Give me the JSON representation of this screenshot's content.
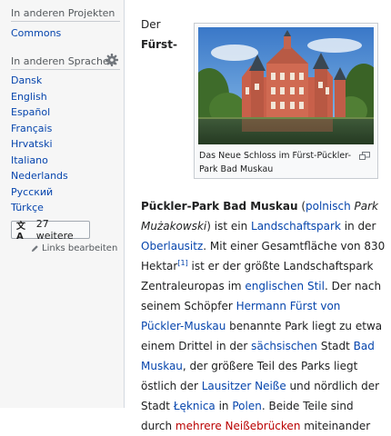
{
  "sidebar": {
    "projects_heading": "In anderen Projekten",
    "projects": [
      "Commons"
    ],
    "languages_heading": "In anderen Sprachen",
    "languages": [
      "Dansk",
      "English",
      "Español",
      "Français",
      "Hrvatski",
      "Italiano",
      "Nederlands",
      "Русский",
      "Türkçe"
    ],
    "more_button": "27 weitere",
    "edit_links": "Links bearbeiten"
  },
  "article": {
    "intro_der": "Der",
    "intro_title": "Fürst-",
    "thumb_caption": "Das Neue Schloss im Fürst-Pückler-Park Bad Muskau",
    "paragraph": [
      {
        "t": "b",
        "text": "Pückler-Park Bad Muskau"
      },
      {
        "t": "s",
        "text": " ("
      },
      {
        "t": "a",
        "text": "polnisch"
      },
      {
        "t": "s",
        "text": " "
      },
      {
        "t": "i",
        "text": "Park Mużakowski"
      },
      {
        "t": "s",
        "text": ") ist ein "
      },
      {
        "t": "a",
        "text": "Landschaftspark"
      },
      {
        "t": "s",
        "text": " in der "
      },
      {
        "t": "a",
        "text": "Oberlausitz"
      },
      {
        "t": "s",
        "text": ". Mit einer Gesamtfläche von 830 Hektar"
      },
      {
        "t": "sup",
        "text": "[1]"
      },
      {
        "t": "s",
        "text": " ist er der größte Landschaftspark Zentraleuropas im "
      },
      {
        "t": "a",
        "text": "englischen Stil"
      },
      {
        "t": "s",
        "text": ". Der nach seinem Schöpfer "
      },
      {
        "t": "a",
        "text": "Hermann Fürst von Pückler-Muskau"
      },
      {
        "t": "s",
        "text": " benannte Park liegt zu etwa einem Drittel in der "
      },
      {
        "t": "a",
        "text": "sächsischen"
      },
      {
        "t": "s",
        "text": " Stadt "
      },
      {
        "t": "a",
        "text": "Bad Muskau"
      },
      {
        "t": "s",
        "text": ", der größere Teil des Parks liegt östlich der "
      },
      {
        "t": "a",
        "text": "Lausitzer Neiße"
      },
      {
        "t": "s",
        "text": " und nördlich der Stadt "
      },
      {
        "t": "a",
        "text": "Łęknica"
      },
      {
        "t": "s",
        "text": " in "
      },
      {
        "t": "a",
        "text": "Polen"
      },
      {
        "t": "s",
        "text": ". Beide Teile sind durch "
      },
      {
        "t": "ar",
        "text": "mehrere Neißebrücken"
      },
      {
        "t": "s",
        "text": " miteinander"
      }
    ]
  },
  "colors": {
    "link": "#0645ad",
    "red_link": "#ba0000"
  },
  "icons": {
    "gear": "gear-icon",
    "translate": "translate-icon",
    "pencil": "pencil-icon",
    "magnify": "magnify-icon"
  }
}
